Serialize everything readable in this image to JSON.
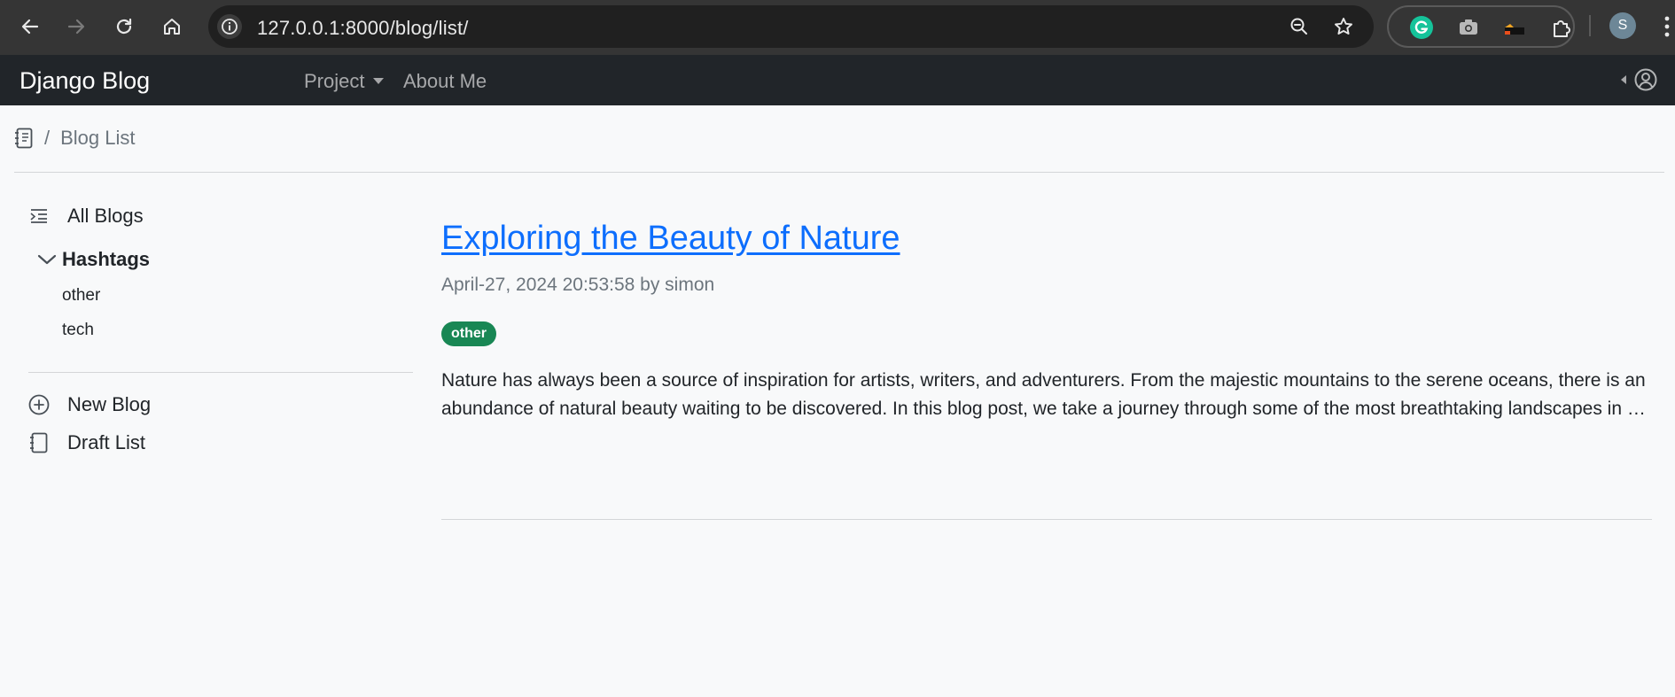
{
  "browser": {
    "url": "127.0.0.1:8000/blog/list/",
    "profile_initial": "S"
  },
  "navbar": {
    "brand": "Django Blog",
    "links": [
      {
        "label": "Project",
        "has_dropdown": true
      },
      {
        "label": "About Me",
        "has_dropdown": false
      }
    ]
  },
  "breadcrumb": {
    "separator": "/",
    "current": "Blog List"
  },
  "sidebar": {
    "all_blogs": "All Blogs",
    "hashtags_label": "Hashtags",
    "hashtags": [
      "other",
      "tech"
    ],
    "new_blog": "New Blog",
    "draft_list": "Draft List"
  },
  "posts": [
    {
      "title": "Exploring the Beauty of Nature",
      "meta": "April-27, 2024 20:53:58 by simon",
      "tag": "other",
      "excerpt": "Nature has always been a source of inspiration for artists, writers, and adventurers. From the majestic mountains to the serene oceans, there is an abundance of natural beauty waiting to be discovered. In this blog post, we take a journey through some of the most breathtaking landscapes in …"
    }
  ],
  "colors": {
    "navbar_bg": "#212529",
    "link": "#0d6efd",
    "badge_bg": "#198754",
    "page_bg": "#f8f9fa"
  }
}
